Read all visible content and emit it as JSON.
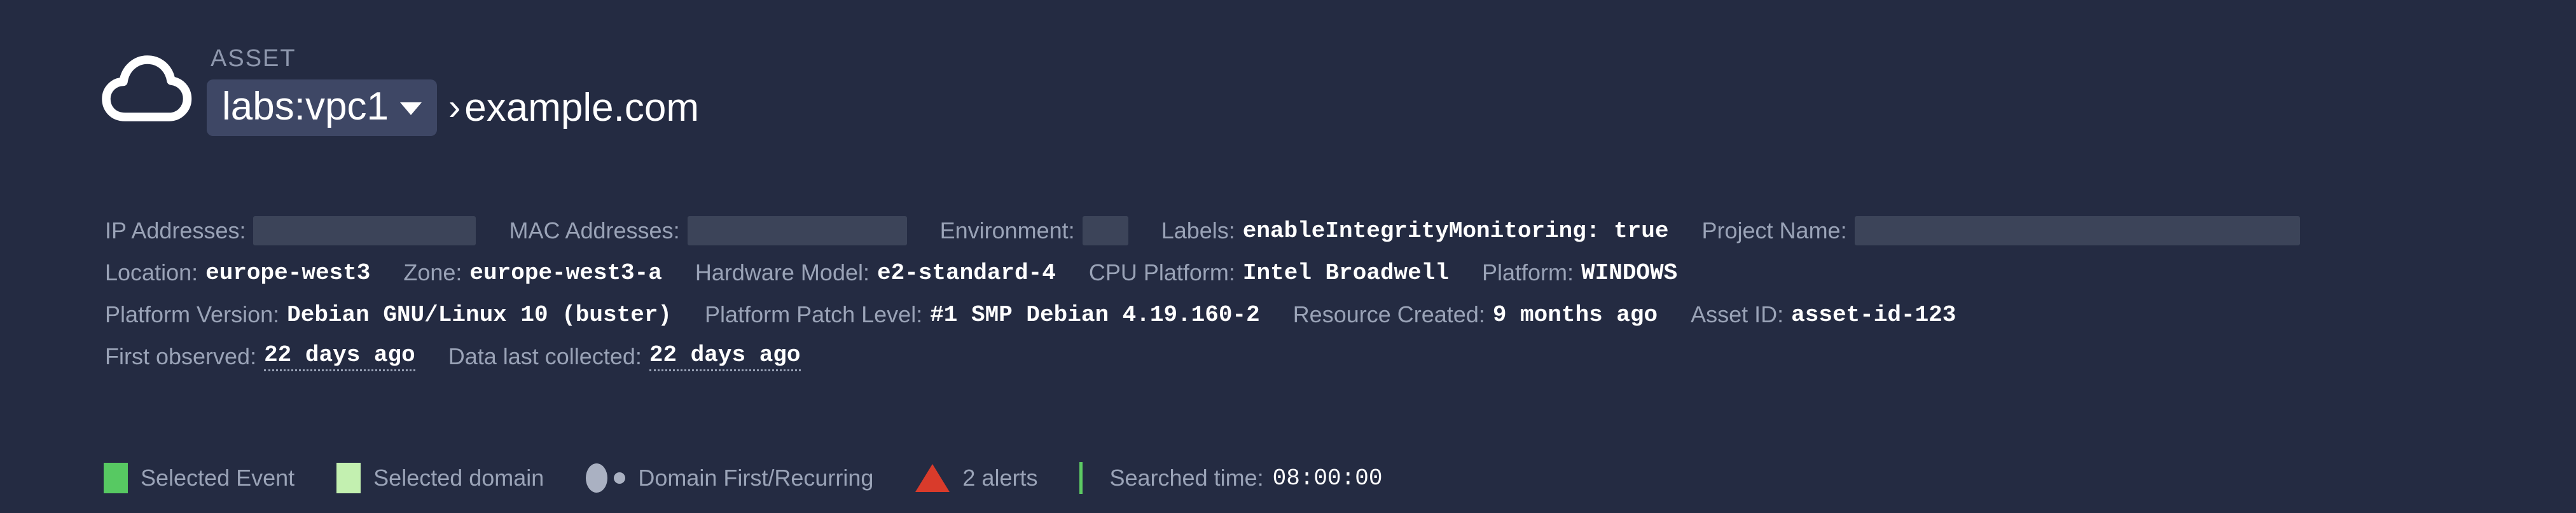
{
  "header": {
    "icon": "cloud-icon",
    "eyebrow": "ASSET",
    "vpc_selector": {
      "label": "labs:vpc1",
      "caret": "chevron-down-icon"
    },
    "separator": "›",
    "domain": "example.com"
  },
  "meta": {
    "rows": [
      {
        "items": [
          {
            "key": "IP Addresses:",
            "value": null,
            "redacted": true,
            "redact_class": "w-ip"
          },
          {
            "key": "MAC Addresses:",
            "value": null,
            "redacted": true,
            "redact_class": "w-mac"
          },
          {
            "key": "Environment:",
            "value": null,
            "redacted": true,
            "redact_class": "w-env"
          },
          {
            "key": "Labels:",
            "value": "enableIntegrityMonitoring: true",
            "redacted": false
          },
          {
            "key": "Project Name:",
            "value": null,
            "redacted": true,
            "redact_class": "w-project"
          }
        ]
      },
      {
        "items": [
          {
            "key": "Location:",
            "value": "europe-west3"
          },
          {
            "key": "Zone:",
            "value": "europe-west3-a"
          },
          {
            "key": "Hardware Model:",
            "value": "e2-standard-4"
          },
          {
            "key": "CPU Platform:",
            "value": "Intel Broadwell"
          },
          {
            "key": "Platform:",
            "value": "WINDOWS"
          }
        ]
      },
      {
        "items": [
          {
            "key": "Platform Version:",
            "value": "Debian GNU/Linux 10 (buster)"
          },
          {
            "key": "Platform Patch Level:",
            "value": "#1 SMP Debian 4.19.160-2"
          },
          {
            "key": "Resource Created:",
            "value": "9 months ago"
          },
          {
            "key": "Asset ID:",
            "value": "asset-id-123"
          }
        ]
      },
      {
        "items": [
          {
            "key": "First observed:",
            "value": "22 days ago",
            "dotted": true
          },
          {
            "key": "Data last collected:",
            "value": "22 days ago",
            "dotted": true
          }
        ]
      }
    ]
  },
  "legend": {
    "selected_event": "Selected Event",
    "selected_domain": "Selected domain",
    "domain_first_recurring": "Domain First/Recurring",
    "alerts": "2 alerts",
    "searched_time_key": "Searched time:",
    "searched_time_value": "08:00:00"
  },
  "colors": {
    "background": "#242b42",
    "redacted_block": "#3c4459",
    "pill_background": "#3e4765",
    "selected_event_green": "#57c962",
    "selected_domain_green": "#c3f0b0",
    "alert_red": "#d93b2b",
    "divider_green": "#5dcb63",
    "key_text": "#9aa3b7",
    "value_text": "#ffffff"
  }
}
